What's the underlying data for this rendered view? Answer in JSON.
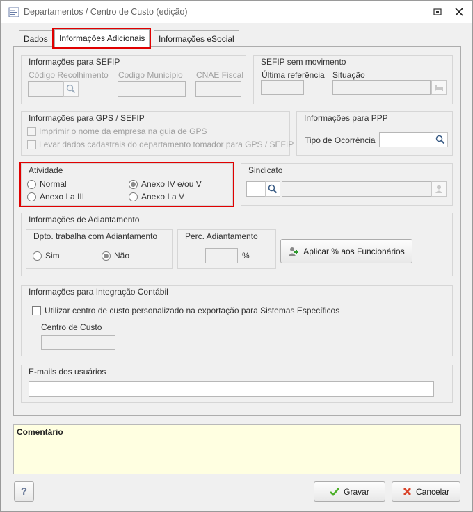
{
  "window": {
    "title": "Departamentos / Centro de Custo (edição)"
  },
  "tabs": [
    {
      "label": "Dados"
    },
    {
      "label": "Informações Adicionais"
    },
    {
      "label": "Informações eSocial"
    }
  ],
  "sefip": {
    "title": "Informações para SEFIP",
    "codigo_recolhimento_label": "Código Recolhimento",
    "codigo_municipio_label": "Codigo Município",
    "cnae_label": "CNAE Fiscal"
  },
  "sefip_sem_mov": {
    "title": "SEFIP sem movimento",
    "ultima_ref_label": "Última referência",
    "situacao_label": "Situação"
  },
  "gps": {
    "title": "Informações para GPS / SEFIP",
    "opt1": "Imprimir o nome da empresa na guia de GPS",
    "opt2": "Levar dados cadastrais do departamento tomador para GPS / SEFIP"
  },
  "ppp": {
    "title": "Informações para PPP",
    "tipo_label": "Tipo de Ocorrência"
  },
  "atividade": {
    "title": "Atividade",
    "opt_normal": "Normal",
    "opt_anexo_iv": "Anexo IV e/ou V",
    "opt_anexo_i_iii": "Anexo I a III",
    "opt_anexo_i_v": "Anexo I a V",
    "selected": "Anexo IV e/ou V"
  },
  "sindicato": {
    "title": "Sindicato"
  },
  "adiantamento": {
    "title": "Informações de Adiantamento",
    "dpto_title": "Dpto. trabalha com Adiantamento",
    "sim": "Sim",
    "nao": "Não",
    "selected": "Não",
    "perc_title": "Perc. Adiantamento",
    "percent_sign": "%",
    "apply_button": "Aplicar % aos Funcionários"
  },
  "integracao": {
    "title": "Informações para Integração Contábil",
    "checkbox_label": "Utilizar centro de custo personalizado na exportação para Sistemas Específicos",
    "centro_label": "Centro de Custo"
  },
  "emails": {
    "title": "E-mails dos usuários"
  },
  "comment": {
    "label": "Comentário"
  },
  "footer": {
    "help": "?",
    "save": "Gravar",
    "cancel": "Cancelar"
  },
  "colors": {
    "highlight": "#e00000",
    "comment_bg": "#ffffe1",
    "save_check": "#4caf28",
    "cancel_x": "#d9452b"
  }
}
